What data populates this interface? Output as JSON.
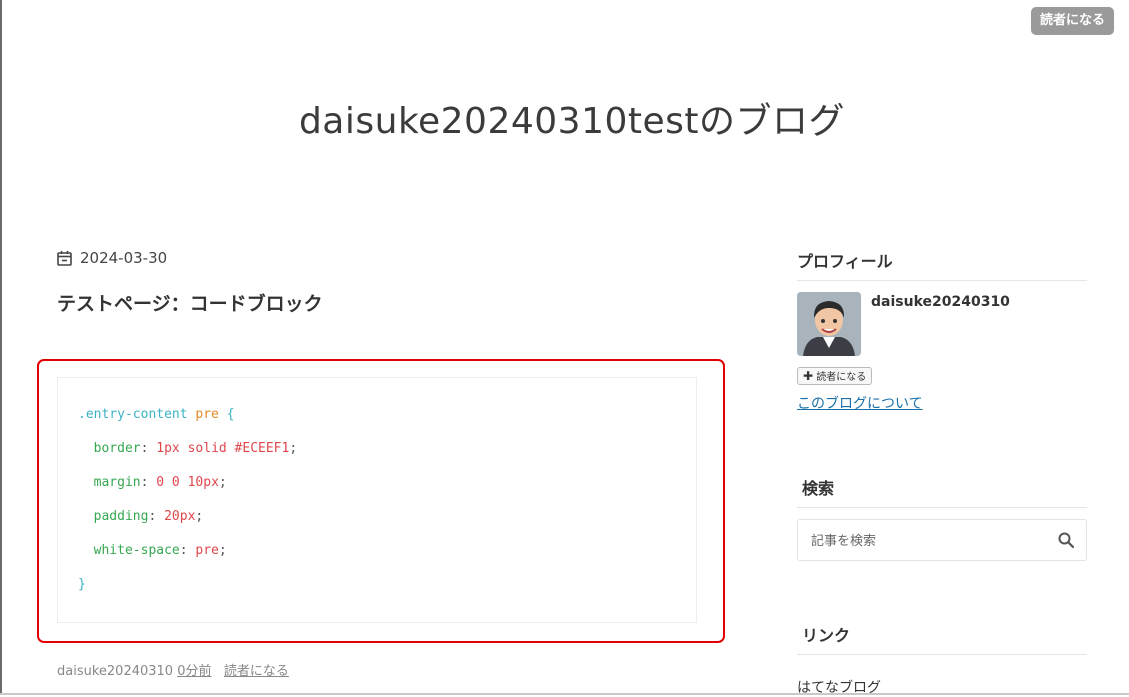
{
  "header": {
    "subscribe_button": "読者になる",
    "blog_title": "daisuke20240310testのブログ"
  },
  "entry": {
    "date": "2024-03-30",
    "title": "テストページ：コードブロック",
    "code": {
      "line1": {
        "selector": ".entry-content",
        "tag": "pre",
        "brace": "{"
      },
      "props": [
        {
          "prop": "border",
          "value": "1px solid #ECEEF1"
        },
        {
          "prop": "margin",
          "value": "0 0 10px"
        },
        {
          "prop": "padding",
          "value": "20px"
        },
        {
          "prop": "white-space",
          "value": "pre"
        }
      ],
      "close": "}"
    },
    "footer": {
      "author": "daisuke20240310",
      "time_ago": "0分前",
      "subscribe": "読者になる"
    }
  },
  "sidebar": {
    "profile": {
      "heading": "プロフィール",
      "name": "daisuke20240310",
      "subscribe": "読者になる",
      "about": "このブログについて"
    },
    "search": {
      "heading": "検索",
      "placeholder": "記事を検索"
    },
    "links": {
      "heading": "リンク",
      "items": [
        "はてなブログ"
      ]
    }
  }
}
